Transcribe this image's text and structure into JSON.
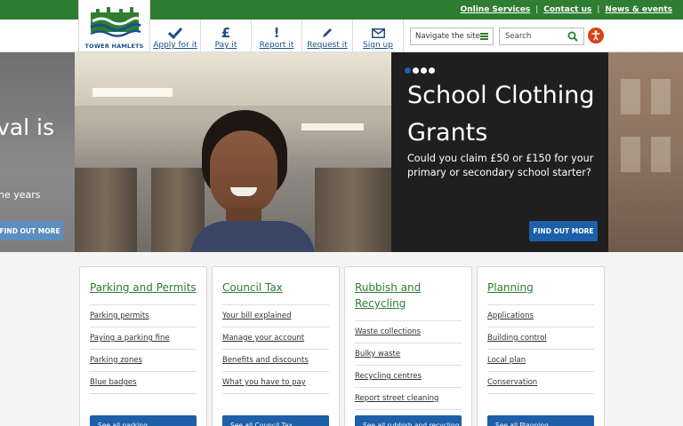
{
  "top_links": [
    "Online Services",
    "Contact us",
    "News & events"
  ],
  "logo": {
    "text": "TOWER HAMLETS"
  },
  "actions": [
    {
      "label": "Apply for it",
      "icon": "checkmark-icon"
    },
    {
      "label": "Pay it",
      "icon": "pound-icon",
      "glyph": "£"
    },
    {
      "label": "Report it",
      "icon": "exclamation-icon",
      "glyph": "!"
    },
    {
      "label": "Request it",
      "icon": "pencil-icon"
    },
    {
      "label": "Sign up",
      "icon": "envelope-icon"
    }
  ],
  "navigate": {
    "label": "Navigate the site",
    "icon": "hamburger-icon"
  },
  "search": {
    "placeholder": "Search",
    "icon": "search-icon"
  },
  "accessibility": {
    "icon": "accessibility-icon"
  },
  "hero": {
    "left_slide": {
      "title_fragment": "val is",
      "text_fragment": "he years",
      "button": "FIND OUT MORE"
    },
    "dots_total": 4,
    "active_dot": 0,
    "title": "School Clothing Grants",
    "description": "Could you claim £50 or £150 for your primary or secondary school starter?",
    "button": "FIND OUT MORE"
  },
  "cards": [
    {
      "title": "Parking and Permits",
      "links": [
        "Parking permits",
        "Paying a parking fine",
        "Parking zones",
        "Blue badges"
      ],
      "see_all": "See all parking"
    },
    {
      "title": "Council Tax",
      "links": [
        "Your bill explained",
        "Manage your account",
        "Benefits and discounts",
        "What you have to pay"
      ],
      "see_all": "See all Council Tax"
    },
    {
      "title": "Rubbish and Recycling",
      "links": [
        "Waste collections",
        "Bulky waste",
        "Recycling centres",
        "Report street cleaning"
      ],
      "see_all": "See all rubbish and recycling"
    },
    {
      "title": "Planning",
      "links": [
        "Applications",
        "Building control",
        "Local plan",
        "Conservation"
      ],
      "see_all": "See all Planning"
    }
  ],
  "colors": {
    "green": "#2e7d32",
    "blue": "#1d5fa8",
    "orange": "#d84315",
    "navy": "#1a4f8b"
  }
}
